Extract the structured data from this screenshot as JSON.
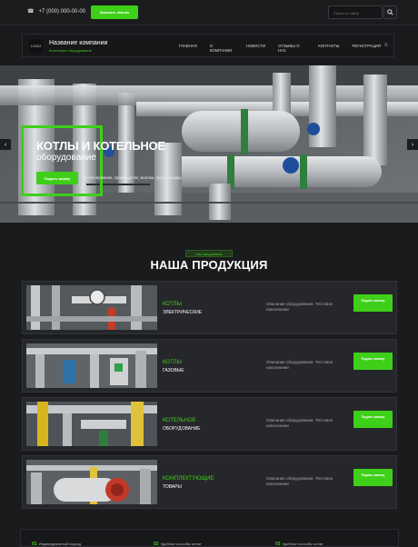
{
  "header": {
    "phone": "+7 (000) 000-00-00",
    "callback_button": "Заказать звонок",
    "search_placeholder": "Поиск по сайту"
  },
  "navbar": {
    "logo_text": "LOGO",
    "company_name": "Название компании",
    "company_tagline": "Котельное оборудование",
    "menu": [
      "ГЛАВНАЯ",
      "О КОМПАНИИ",
      "НОВОСТИ",
      "ОТЗЫВЫ О НАС",
      "КОНТАКТЫ",
      "РЕГИСТРАЦИЯ"
    ]
  },
  "hero": {
    "title": "КОТЛЫ И КОТЕЛЬНОЕ",
    "subtitle": "оборудование",
    "button": "Подать заявку",
    "description": "Проектирование, производство, монтаж, пуско-наладка"
  },
  "products": {
    "badge": "Мы предлагаем",
    "title": "НАША ПРОДУКЦИЯ",
    "items": [
      {
        "green": "КОТЛЫ",
        "white": "ЭЛЕКТРИЧЕСКИЕ",
        "desc": "Описание оборудования. Тестовое наполнение",
        "button": "Подать заявку"
      },
      {
        "green": "КОТЛЫ",
        "white": "ГАЗОВЫЕ",
        "desc": "Описание оборудования. Тестовое наполнение",
        "button": "Подать заявку"
      },
      {
        "green": "КОТЕЛЬНОЕ",
        "white": "ОБОРУДОВАНИЕ",
        "desc": "Описание оборудования. Тестовое наполнение",
        "button": "Подать заявку"
      },
      {
        "green": "КОМПЛЕКТУЮЩИЕ",
        "white": "ТОВАРЫ",
        "desc": "Описание оборудования. Тестовое наполнение",
        "button": "Подать заявку"
      }
    ]
  },
  "footer_strip": [
    {
      "num": "01",
      "text": "Индивидуальный подход"
    },
    {
      "num": "02",
      "text": "Удобные способы оплат"
    },
    {
      "num": "03",
      "text": "Удобные способы оплат"
    }
  ],
  "colors": {
    "accent": "#3ed019",
    "background": "#1a1b1d"
  }
}
